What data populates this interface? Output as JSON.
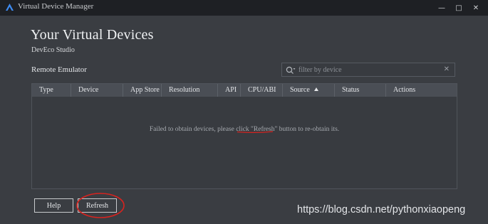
{
  "window": {
    "title": "Virtual Device Manager",
    "min_glyph": "—",
    "max_glyph": "□",
    "close_glyph": "✕",
    "app_icon": "deveco-logo-icon"
  },
  "page": {
    "title": "Your Virtual Devices",
    "subtitle": "DevEco Studio",
    "section": "Remote Emulator"
  },
  "filter": {
    "placeholder": "filter by device",
    "value": "",
    "search_icon": "search-icon",
    "clear_glyph": "✕"
  },
  "table": {
    "columns": [
      "Type",
      "Device",
      "App Store",
      "Resolution",
      "API",
      "CPU/ABI",
      "Source",
      "Status",
      "Actions"
    ],
    "sorted_column": "Source",
    "sort_direction": "ascending",
    "rows": [],
    "empty_message": "Failed to obtain devices, please click \"Refresh\" button to re-obtain its."
  },
  "buttons": {
    "help": "Help",
    "refresh": "Refresh"
  },
  "annotations": {
    "highlight_color": "#d8231f"
  },
  "watermark": "https://blog.csdn.net/pythonxiaopeng"
}
